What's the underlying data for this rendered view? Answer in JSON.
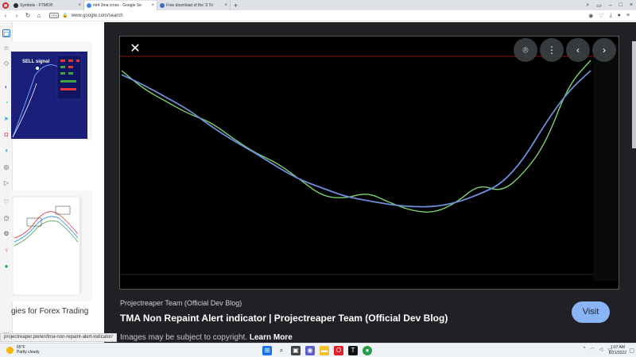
{
  "browser": {
    "tabs": [
      {
        "label": "Symbols - FTMO®",
        "favicon_color": "#2b2b2b",
        "active": false
      },
      {
        "label": "mt4 3ma cross - Google Se",
        "favicon_color": "#4285f4",
        "active": true
      },
      {
        "label": "Free download of the '3 Tri",
        "favicon_color": "#3d6cc9",
        "active": false
      }
    ],
    "new_tab": "+",
    "address": "www.google.com/search",
    "vpn_badge": "VPN"
  },
  "left_panel": {
    "sell_signal_label": "SELL signal",
    "caption": "gies for Forex Trading"
  },
  "preview": {
    "source": "Projectreaper Team (Official Dev Blog)",
    "title": "TMA Non Repaint Alert indicator | Projectreaper Team (Official Dev Blog)",
    "visit_label": "Visit",
    "disclaimer": "Images may be subject to copyright.",
    "learn_more": "Learn More"
  },
  "status_url": "projectreaper.pw/en/tma-non-repaint-alert-indicator/",
  "chart_data": {
    "type": "line",
    "series": [
      {
        "values": [
          0.95,
          0.86,
          0.8,
          0.74,
          0.7,
          0.62,
          0.55,
          0.5,
          0.42,
          0.34,
          0.33,
          0.36,
          0.31,
          0.27,
          0.26,
          0.31,
          0.4,
          0.36,
          0.45,
          0.6,
          0.88,
          1.0
        ]
      },
      {
        "values": [
          0.93,
          0.88,
          0.82,
          0.76,
          0.68,
          0.61,
          0.55,
          0.48,
          0.42,
          0.38,
          0.34,
          0.32,
          0.3,
          0.29,
          0.29,
          0.31,
          0.35,
          0.4,
          0.52,
          0.7,
          0.85,
          0.95
        ]
      }
    ]
  },
  "taskbar": {
    "temperature": "65°F",
    "weather": "Partly cloudy",
    "time": "1:07 AM",
    "date": "8/21/2022"
  }
}
